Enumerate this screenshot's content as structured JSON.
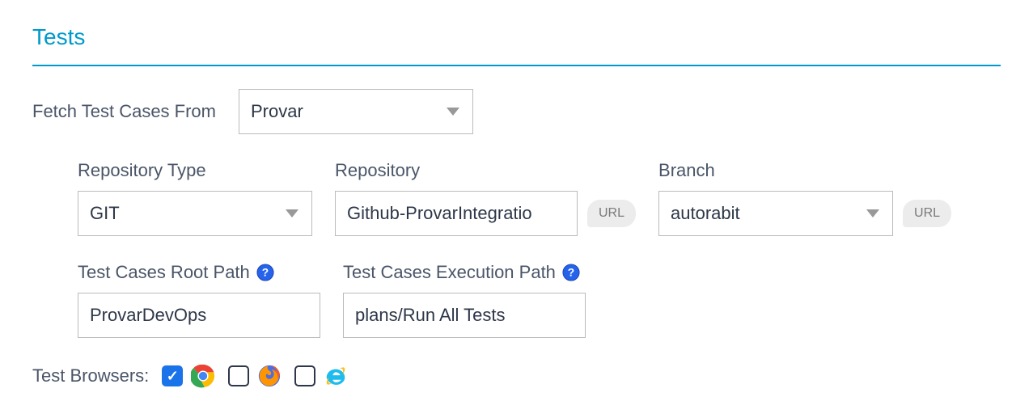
{
  "section": {
    "title": "Tests"
  },
  "fetch": {
    "label": "Fetch Test Cases From",
    "value": "Provar"
  },
  "repository_type": {
    "label": "Repository Type",
    "value": "GIT"
  },
  "repository": {
    "label": "Repository",
    "value": "Github-ProvarIntegratio",
    "url_label": "URL"
  },
  "branch": {
    "label": "Branch",
    "value": "autorabit",
    "url_label": "URL"
  },
  "root_path": {
    "label": "Test Cases Root Path",
    "value": "ProvarDevOps"
  },
  "exec_path": {
    "label": "Test Cases Execution Path",
    "value": "plans/Run All Tests"
  },
  "browsers": {
    "label": "Test Browsers:",
    "chrome_checked": true,
    "firefox_checked": false,
    "ie_checked": false
  }
}
